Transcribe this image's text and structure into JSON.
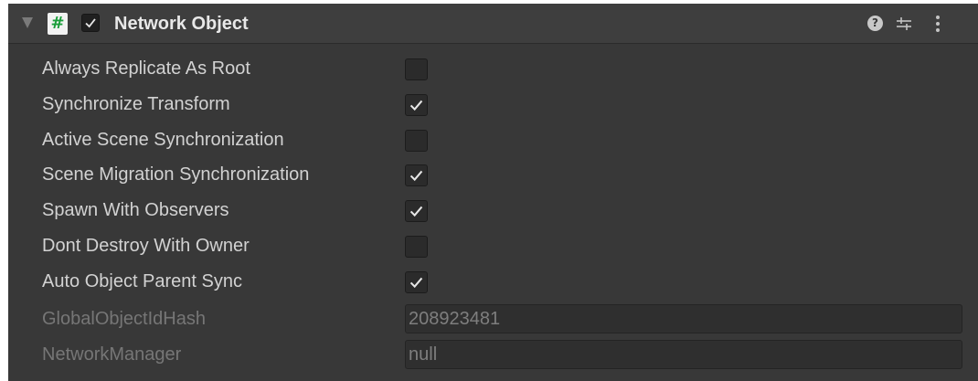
{
  "header": {
    "title": "Network Object",
    "enabled": true,
    "script_icon_glyph": "#",
    "help_glyph": "?",
    "icons": [
      "foldout-arrow-icon",
      "script-icon",
      "checkmark-icon",
      "help-icon",
      "preset-icon",
      "kebab-menu-icon"
    ]
  },
  "properties": [
    {
      "label": "Always Replicate As Root",
      "checked": false
    },
    {
      "label": "Synchronize Transform",
      "checked": true
    },
    {
      "label": "Active Scene Synchronization",
      "checked": false
    },
    {
      "label": "Scene Migration Synchronization",
      "checked": true
    },
    {
      "label": "Spawn With Observers",
      "checked": true
    },
    {
      "label": "Dont Destroy With Owner",
      "checked": false
    },
    {
      "label": "Auto Object Parent Sync",
      "checked": true
    }
  ],
  "readonly_fields": [
    {
      "label": "GlobalObjectIdHash",
      "value": "208923481"
    },
    {
      "label": "NetworkManager",
      "value": "null"
    }
  ],
  "colors": {
    "panel_bg": "#383838",
    "header_bg": "#3e3e3e",
    "label_text": "#d2d2d2",
    "disabled_text": "#767676",
    "checkmark": "#e6e6e6",
    "script_icon_hash": "#1a9e3a"
  }
}
